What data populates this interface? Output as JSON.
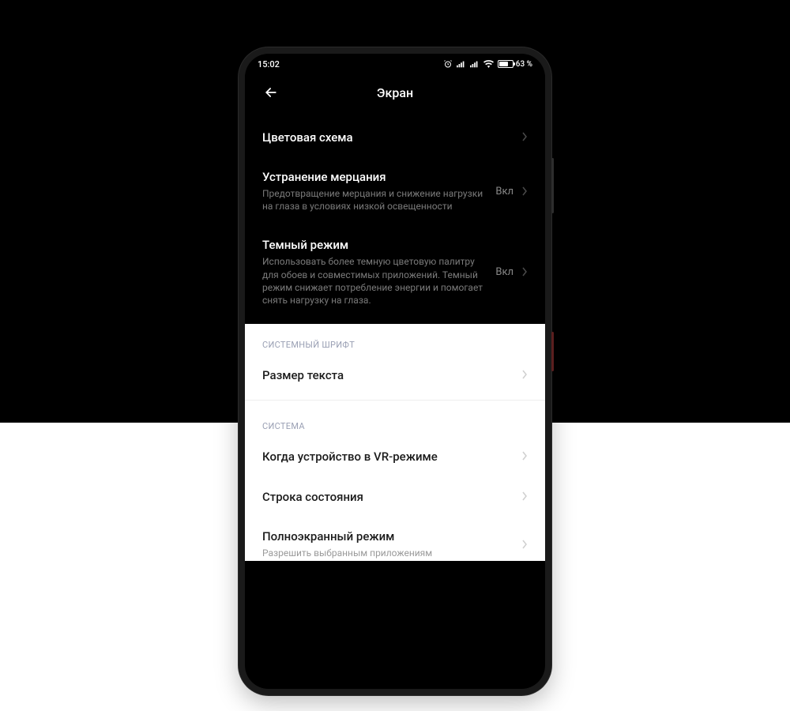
{
  "statusbar": {
    "time": "15:02",
    "battery_pct": "63 %"
  },
  "header": {
    "title": "Экран"
  },
  "rows": {
    "color_scheme": {
      "title": "Цветовая схема"
    },
    "flicker": {
      "title": "Устранение мерцания",
      "desc": "Предотвращение мерцания и снижение нагрузки на глаза в условиях низкой освещенности",
      "value": "Вкл"
    },
    "dark_mode": {
      "title": "Темный режим",
      "desc": "Использовать более темную цветовую палитру для обоев и совместимых приложений. Темный режим снижает потребление энергии и помогает снять нагрузку на глаза.",
      "value": "Вкл"
    },
    "text_size": {
      "title": "Размер текста"
    },
    "vr_mode": {
      "title": "Когда устройство в VR-режиме"
    },
    "status_bar": {
      "title": "Строка состояния"
    },
    "fullscreen": {
      "title": "Полноэкранный режим",
      "desc": "Разрешить выбранным приложениям"
    }
  },
  "sections": {
    "font": "СИСТЕМНЫЙ ШРИФТ",
    "system": "СИСТЕМА"
  }
}
